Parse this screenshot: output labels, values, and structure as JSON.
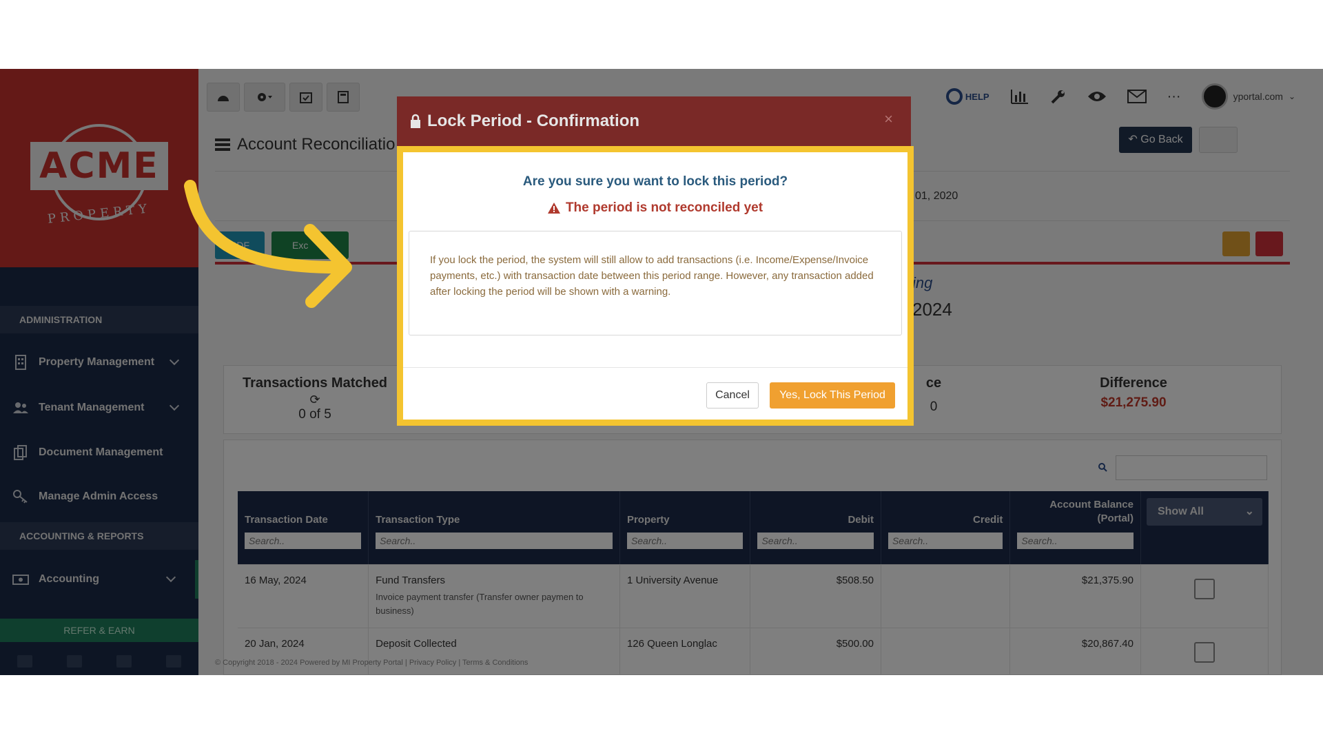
{
  "brand": {
    "logo_text": "ACME",
    "logo_sub": "PROPERTY"
  },
  "sidebar": {
    "section_admin": "ADMINISTRATION",
    "section_accounting": "ACCOUNTING & REPORTS",
    "items": [
      {
        "label": "Property Management",
        "icon": "building-icon"
      },
      {
        "label": "Tenant Management",
        "icon": "users-icon"
      },
      {
        "label": "Document Management",
        "icon": "documents-icon"
      },
      {
        "label": "Manage Admin Access",
        "icon": "key-icon"
      },
      {
        "label": "Accounting",
        "icon": "money-icon"
      }
    ],
    "refer": "REFER & EARN"
  },
  "topbar": {
    "help": "HELP",
    "user_email": "yportal.com"
  },
  "page": {
    "title": "Account Reconciliatio",
    "go_back": "Go Back",
    "date_range": "01, 2020",
    "pdf": "PDF",
    "excel": "Exc",
    "report_sub": "ing",
    "report_year": "2024"
  },
  "summary": {
    "matched_title": "Transactions Matched",
    "matched_value": "0 of 5",
    "balance_title": "ce",
    "balance_value": "0",
    "difference_title": "Difference",
    "difference_value": "$21,275.90"
  },
  "table": {
    "headers": [
      "Transaction Date",
      "Transaction Type",
      "Property",
      "Debit",
      "Credit",
      "Account Balance (Portal)"
    ],
    "show_all": "Show All",
    "search_placeholder": "Search..",
    "rows": [
      {
        "date": "16 May, 2024",
        "type": "Fund Transfers",
        "desc": "Invoice payment transfer (Transfer owner paymen to business)",
        "property": "1 University Avenue",
        "debit": "$508.50",
        "credit": "",
        "balance": "$21,375.90"
      },
      {
        "date": "20 Jan, 2024",
        "type": "Deposit Collected",
        "desc": "",
        "property": "126 Queen Longlac",
        "debit": "$500.00",
        "credit": "",
        "balance": "$20,867.40"
      }
    ]
  },
  "footer": "© Copyright 2018 - 2024 Powered by MI Property Portal | Privacy Policy | Terms & Conditions",
  "modal": {
    "title": "Lock Period - Confirmation",
    "close": "×",
    "question": "Are you sure you want to lock this period?",
    "warning": "The period is not reconciled yet",
    "info": "If you lock the period, the system will still allow to add transactions (i.e. Income/Expense/Invoice payments, etc.) with transaction date between this period range. However, any transaction added after locking the period will be shown with a warning.",
    "cancel": "Cancel",
    "confirm": "Yes, Lock This Period"
  },
  "colors": {
    "brand_red": "#c8322f",
    "sidebar": "#1b2a48",
    "highlight": "#f4c430",
    "modal_header": "#7a2927",
    "confirm": "#f0a030"
  }
}
